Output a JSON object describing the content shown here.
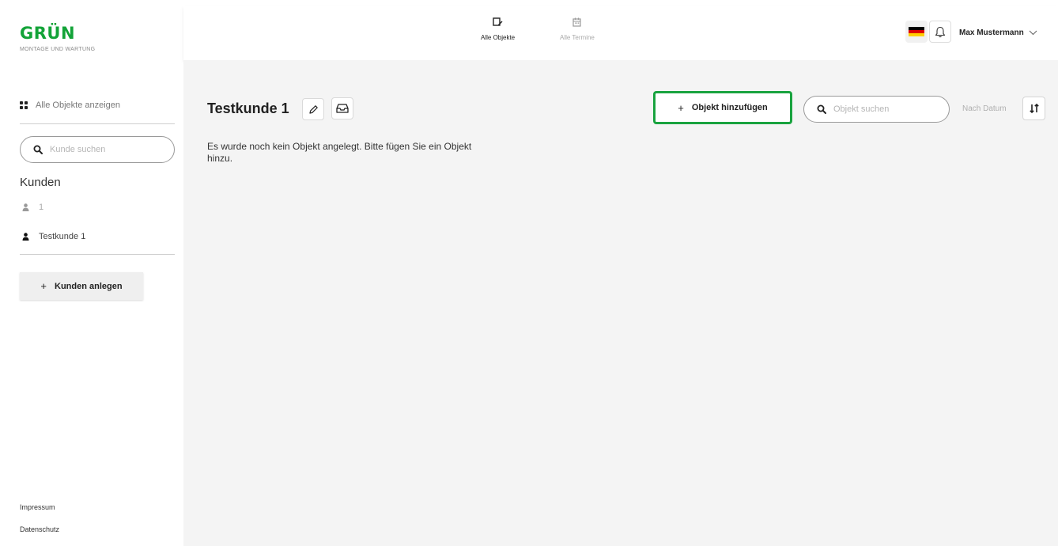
{
  "brand": {
    "name": "GRÜN",
    "tagline": "MONTAGE UND WARTUNG",
    "color": "#13a338"
  },
  "sidebar": {
    "all_objects_label": "Alle Objekte anzeigen",
    "search_placeholder": "Kunde suchen",
    "section_title": "Kunden",
    "customers": [
      {
        "label": "1",
        "active": false
      },
      {
        "label": "Testkunde 1",
        "active": true
      }
    ],
    "add_customer_label": "Kunden anlegen",
    "add_symbol": "+",
    "footer_links": [
      "Impressum",
      "Datenschutz"
    ]
  },
  "header": {
    "nav": [
      {
        "label": "Alle Objekte",
        "icon": "object-edit-icon",
        "active": true
      },
      {
        "label": "Alle Termine",
        "icon": "calendar-icon",
        "active": false
      }
    ],
    "language_flag": "german-flag-icon",
    "notification_icon": "bell-icon",
    "user_name": "Max Mustermann"
  },
  "main": {
    "title": "Testkunde 1",
    "empty_message": "Es wurde noch kein Objekt angelegt. Bitte fügen Sie ein Objekt hinzu.",
    "add_object_label": "Objekt hinzufügen",
    "add_symbol": "+",
    "search_placeholder": "Objekt suchen",
    "sort_label": "Nach Datum",
    "sort_icon": "sort-arrows-icon"
  },
  "colors": {
    "accent_green": "#19a33f",
    "flag_black": "#000000",
    "flag_red": "#dd0000",
    "flag_gold": "#ffce00"
  }
}
